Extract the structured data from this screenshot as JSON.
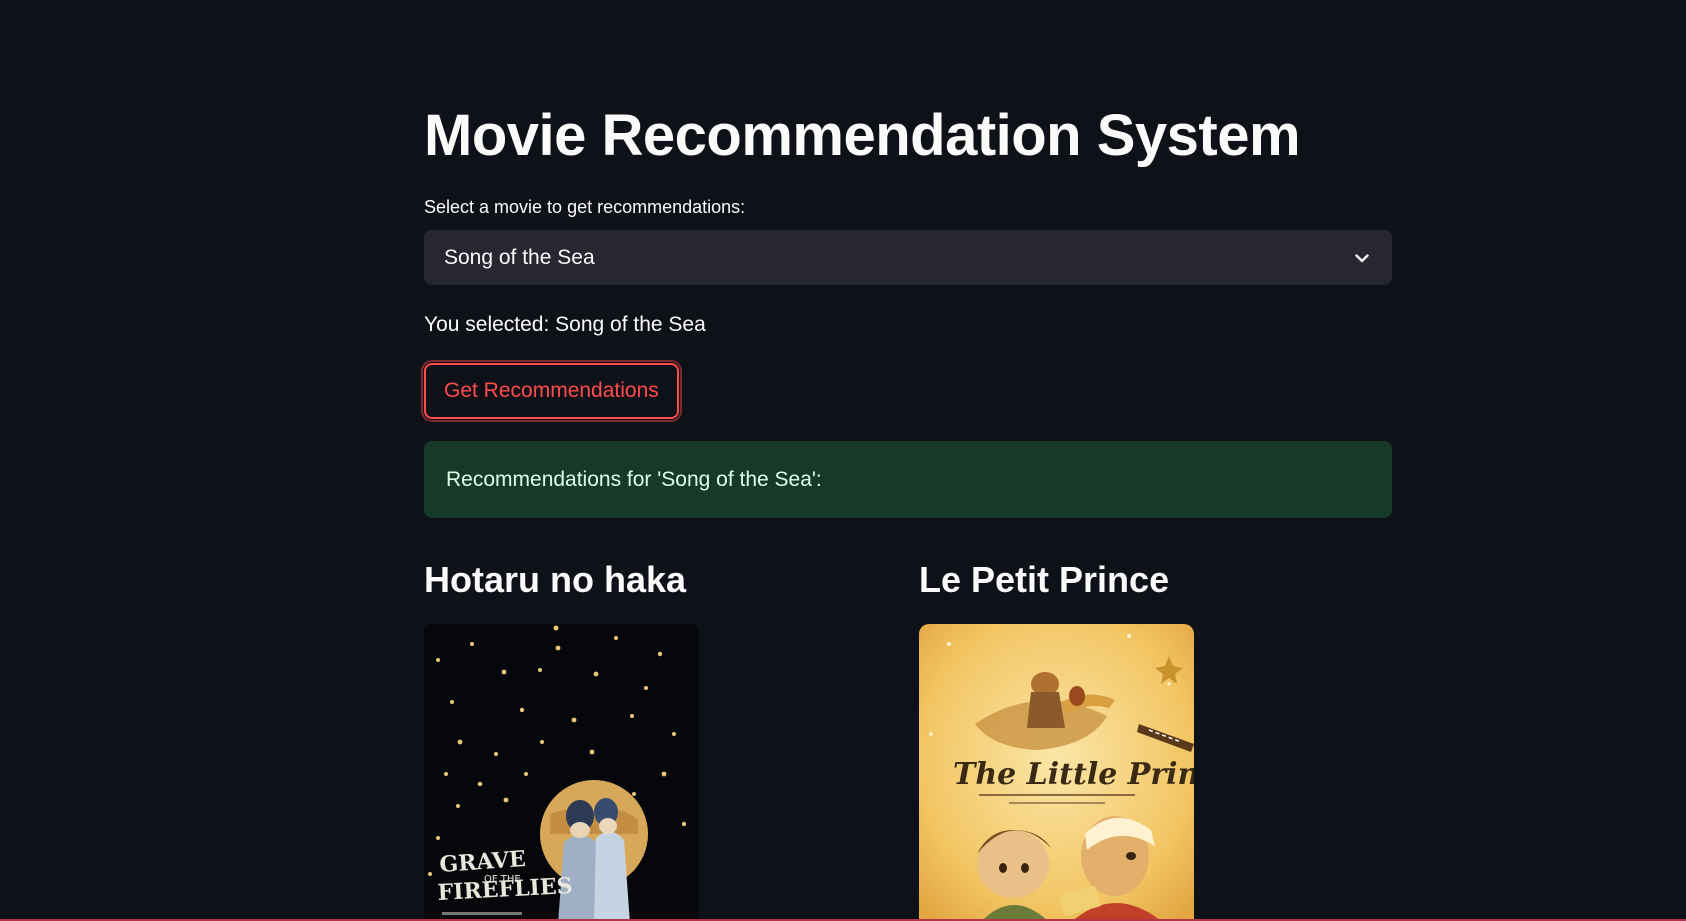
{
  "app": {
    "title": "Movie Recommendation System"
  },
  "selector": {
    "label": "Select a movie to get recommendations:",
    "value": "Song of the Sea"
  },
  "selection_message": "You selected: Song of the Sea",
  "button": {
    "label": "Get Recommendations"
  },
  "success": {
    "message": "Recommendations for 'Song of the Sea':"
  },
  "recommendations": [
    {
      "title": "Hotaru no haka",
      "poster_text": "GRAVE OF THE FIREFLIES"
    },
    {
      "title": "Le Petit Prince",
      "poster_text": "The Little Prince"
    }
  ],
  "colors": {
    "background": "#0e1117",
    "primary": "#ff4b4b",
    "input_bg": "#262730",
    "success_bg": "#173928"
  }
}
